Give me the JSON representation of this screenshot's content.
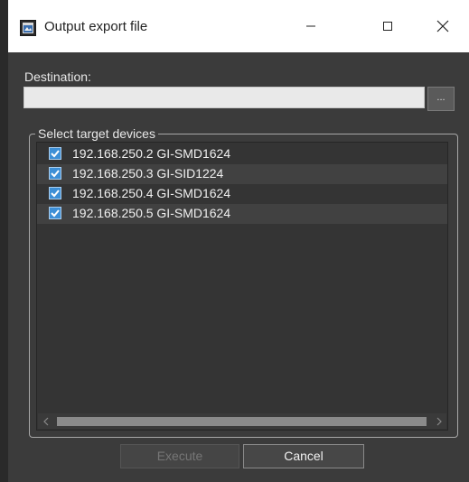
{
  "window": {
    "title": "Output export file",
    "icon": "app-window-icon",
    "controls": {
      "minimize": "minimize-icon",
      "maximize": "maximize-icon",
      "close": "close-icon"
    }
  },
  "destination": {
    "label": "Destination:",
    "value": "",
    "browse_label": "..."
  },
  "devices": {
    "group_label": "Select target devices",
    "items": [
      {
        "label": "192.168.250.2 GI-SMD1624",
        "checked": true
      },
      {
        "label": "192.168.250.3 GI-SID1224",
        "checked": true
      },
      {
        "label": "192.168.250.4 GI-SMD1624",
        "checked": true
      },
      {
        "label": "192.168.250.5 GI-SMD1624",
        "checked": true
      }
    ]
  },
  "buttons": {
    "execute_label": "Execute",
    "cancel_label": "Cancel"
  },
  "colors": {
    "background": "#3b3b3b",
    "list_background": "#343434",
    "checkbox": "#3d8fd6",
    "titlebar": "#ffffff"
  }
}
